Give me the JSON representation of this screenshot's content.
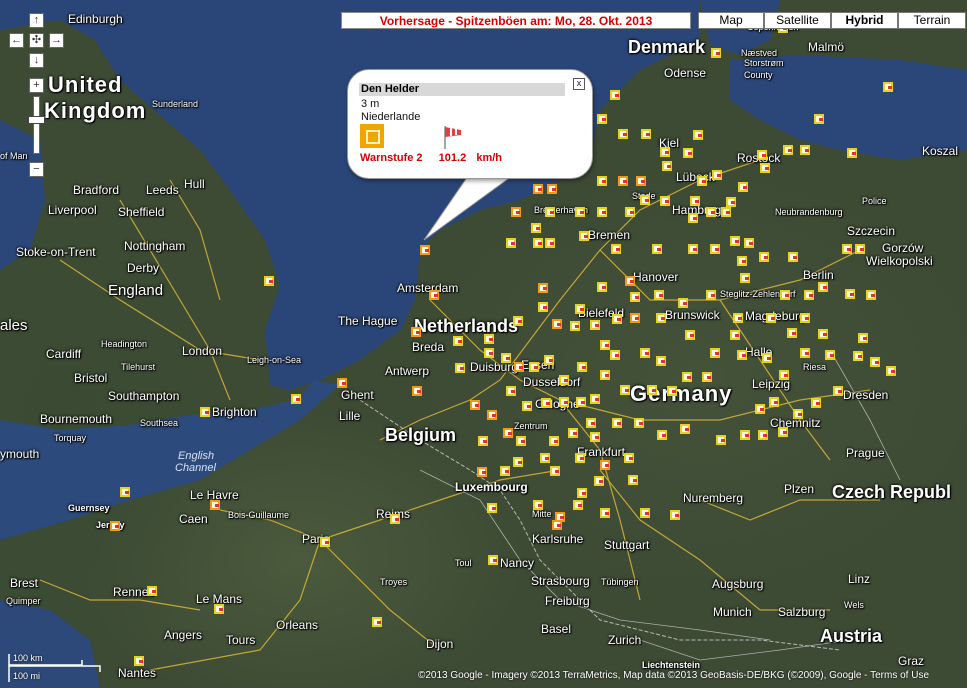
{
  "header": {
    "title": "Vorhersage - Spitzenböen am: Mo, 28. Okt. 2013"
  },
  "map_types": [
    {
      "label": "Map",
      "active": false
    },
    {
      "label": "Satellite",
      "active": false
    },
    {
      "label": "Hybrid",
      "active": true
    },
    {
      "label": "Terrain",
      "active": false
    }
  ],
  "nav": {
    "up": "↑",
    "left": "←",
    "center": "✣",
    "right": "→",
    "down": "↓",
    "zoom_in": "+",
    "zoom_out": "−"
  },
  "popup": {
    "station": "Den Helder",
    "elevation": "3 m",
    "country": "Niederlande",
    "warning": "Warnstufe 2",
    "gust": "101.2",
    "unit": "km/h",
    "close": "x"
  },
  "places": {
    "edinburgh": "Edinburgh",
    "united": "United",
    "kingdom": "Kingdom",
    "sunderland": "Sunderland",
    "isle_of_man": "of Man",
    "bradford": "Bradford",
    "leeds": "Leeds",
    "hull": "Hull",
    "liverpool": "Liverpool",
    "sheffield": "Sheffield",
    "stoke": "Stoke-on-Trent",
    "nottingham": "Nottingham",
    "derby": "Derby",
    "england": "England",
    "wales": "ales",
    "cardiff": "Cardiff",
    "bristol": "Bristol",
    "london": "London",
    "headington": "Headington",
    "tilehurst": "Tilehurst",
    "leigh": "Leigh-on-Sea",
    "southampton": "Southampton",
    "bournemouth": "Bournemouth",
    "brighton": "Brighton",
    "southsea": "Southsea",
    "torquay": "Torquay",
    "plymouth": "ymouth",
    "english_channel_1": "English",
    "english_channel_2": "Channel",
    "guernsey": "Guernsey",
    "jersey": "Jersey",
    "le_havre": "Le Havre",
    "caen": "Caen",
    "bois_guillaume": "Bois-Guillaume",
    "reims": "Reims",
    "paris": "Paris",
    "brest": "Brest",
    "quimper": "Quimper",
    "rennes": "Rennes",
    "le_mans": "Le Mans",
    "orleans": "Orleans",
    "troyes": "Troyes",
    "angers": "Angers",
    "tours": "Tours",
    "nantes": "Nantes",
    "dijon": "Dijon",
    "lille": "Lille",
    "ghent": "Ghent",
    "antwerp": "Antwerp",
    "belgium": "Belgium",
    "luxembourg": "Luxembourg",
    "amsterdam": "Amsterdam",
    "the_hague": "The Hague",
    "netherlands": "Netherlands",
    "breda": "Breda",
    "duisburg": "Duisburg",
    "essen": "Essen",
    "dusseldorf": "Dusseldorf",
    "cologne": "Cologne",
    "zentrum": "Zentrum",
    "denmark": "Denmark",
    "copenhagen": "Copenhagen",
    "malmo": "Malmö",
    "odense": "Odense",
    "nesbyen": "Næstved",
    "storstrom": "Storstrøm",
    "county": "County",
    "kiel": "Kiel",
    "rostock": "Rostock",
    "lubeck": "Lübeck",
    "hamburg": "Hamburg",
    "bremen": "Bremen",
    "bremerhaven": "Bremerhaven",
    "stade": "Stade",
    "neubrandenburg": "Neubrandenburg",
    "police": "Police",
    "koszalin": "Koszal",
    "szczecin": "Szczecin",
    "gorzow_1": "Gorzów",
    "gorzow_2": "Wielkopolski",
    "berlin": "Berlin",
    "hanover": "Hanover",
    "brunswick": "Brunswick",
    "bielefeld": "Bielefeld",
    "magdeburg": "Magdeburg",
    "kreuzberg": "Steglitz-Zehlendorf",
    "halle": "Halle",
    "riesa": "Riesa",
    "leipzig": "Leipzig",
    "dresden": "Dresden",
    "germany": "Germany",
    "chemnitz": "Chemnitz",
    "frankfurt": "Frankfurt",
    "prague": "Prague",
    "czech": "Czech Republ",
    "plzen": "Plzen",
    "nuremberg": "Nuremberg",
    "mitte": "Mitte",
    "karlsruhe": "Karlsruhe",
    "stuttgart": "Stuttgart",
    "toul": "Toul",
    "nancy": "Nancy",
    "strasbourg": "Strasbourg",
    "tubingen": "Tübingen",
    "augsburg": "Augsburg",
    "linz": "Linz",
    "freiburg": "Freiburg",
    "munich": "Munich",
    "salzburg": "Salzburg",
    "wels": "Wels",
    "basel": "Basel",
    "zurich": "Zurich",
    "austria": "Austria",
    "liechtenstein": "Liechtenstein",
    "graz": "Graz"
  },
  "scale": {
    "metric": "100 km",
    "imperial": "100 mi"
  },
  "copyright": "©2013 Google - Imagery ©2013 TerraMetrics, Map data ©2013 GeoBasis-DE/BKG (©2009), Google - Terms of Use",
  "colors": {
    "warning_red": "#d40000",
    "marker_yellow": "#e6d21e",
    "marker_orange": "#f09a17",
    "sea": "#2b4a7e"
  }
}
